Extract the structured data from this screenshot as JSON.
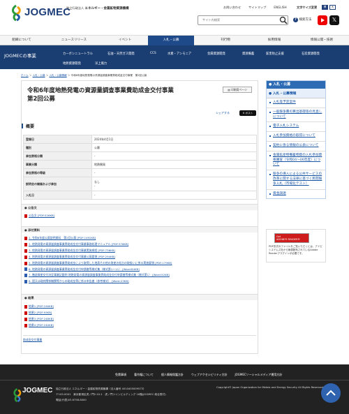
{
  "header": {
    "logo_text": "JOGMEC",
    "org_small": "独立行政法人",
    "org_main": "エネルギー・金属鉱物資源機構",
    "links": [
      "お問い合わせ",
      "サイトマップ",
      "ENGLISH"
    ],
    "font_size_label": "文字サイズ変更",
    "font_size_options": [
      "標",
      "大"
    ],
    "search_placeholder": "サイト内検索",
    "search_method": "検索方法"
  },
  "global_nav": [
    {
      "label": "組織について"
    },
    {
      "label": "ニュースリリース"
    },
    {
      "label": "イベント"
    },
    {
      "label": "入札・公募",
      "active": true
    },
    {
      "label": "刊行物"
    },
    {
      "label": "採用情報"
    },
    {
      "label": "情報公開・技術"
    }
  ],
  "sub_nav": {
    "title": "JOGMECの事業",
    "row1": [
      "カーボンニュートラル",
      "石油・天然ガス開発",
      "CCS",
      "水素・アンモニア",
      "金属資源開発",
      "資源備蓄",
      "鉱害防止支援",
      "石炭資源開発"
    ],
    "row2": [
      "地熱資源開発",
      "洋上風力"
    ]
  },
  "breadcrumb": [
    "ホーム",
    "入札・公募",
    "入札・公募情報",
    "令和6年度地熱発電の資源量調査事業費助成金交付事業　第2回公募"
  ],
  "page": {
    "title_line1": "令和6年度地熱発電の資源量調査事業費助成金交付事業",
    "title_line2": "第2回公募",
    "print_label": "印刷用ページ",
    "share_label": "シェアする",
    "x_post_label": "X ポスト",
    "overview_heading": "概要",
    "overview_rows": [
      {
        "label": "登録日",
        "value": "2024年4月1日"
      },
      {
        "label": "種別",
        "value": "公募"
      },
      {
        "label": "参加資格分類",
        "value": "-"
      },
      {
        "label": "事業分類",
        "value": "地熱開発"
      },
      {
        "label": "参加資格の等級",
        "value": "-"
      },
      {
        "label": "説明会の開催および参加",
        "value": "なし",
        "value2": "-"
      },
      {
        "label": "入札日",
        "value": "-"
      }
    ],
    "notice_heading": "公告文",
    "notice_files": [
      {
        "label": "公告文 [PDF:526KB]",
        "type": "pdf"
      }
    ],
    "attach_heading": "添付資料",
    "attach_files": [
      {
        "label": "1. 令和6年度公募説明資料　第2回公募 [PDF:1492KB]",
        "type": "pdf"
      },
      {
        "label": "2. 地熱発電の資源量調査事業費助成金交付事業事務処理マニュアル [PDF:376KB]",
        "type": "pdf"
      },
      {
        "label": "3. 地熱発電の資源量調査事業費助成金交付事業実施規程 [PDF:736KB]",
        "type": "pdf"
      },
      {
        "label": "4. 地熱発電の資源量調査事業費助成金交付事業公募要領 [PDF:294KB]",
        "type": "pdf"
      },
      {
        "label": "5. 地熱発電の資源量調査事業費助成金により取得した地表その他の財産の処分の取扱いに係る実施要領 [PDF:179KB]",
        "type": "pdf"
      },
      {
        "label": "6. 地熱発電の資源量調査事業費助成金交付申請書等様式集（様式第1〜11） [Word:84KB]",
        "type": "word"
      },
      {
        "label": "7. 撤退資産交付決定事業記載例 地熱発電の資源量調査事業費助成金交付申請書等様式集（様式第1） [Word:52KB]",
        "type": "word"
      },
      {
        "label": "8. 国又は政府関係機関等からの助成金等に係る申告書（参考様式） [Word:23KB]",
        "type": "word"
      }
    ],
    "result_heading": "結果",
    "result_files": [
      {
        "label": "結果1 [PDF:190KB]",
        "type": "pdf"
      },
      {
        "label": "結果2 [PDF:93KB]",
        "type": "pdf"
      },
      {
        "label": "結果3 [PDF:248KB]",
        "type": "pdf"
      },
      {
        "label": "結果4 [PDF:240KB]",
        "type": "pdf"
      }
    ],
    "bottom_link": "助成金交付事業"
  },
  "sidebar": {
    "header": "入札・公募",
    "sub_header": "入札・公募情報",
    "items": [
      "入札等予定案件",
      "一般競争費の算出基礎等の見直しについて",
      "電子入札システム",
      "入札参加資格の取得について",
      "契約に係る情報の公表について",
      "金属鉱産物備蓄物資の入札参加資格審査（令和04〜06年度）について",
      "競争の導入による公共サービスの改革に関する法律に基づく民間競争入札（市場化テスト）",
      "資金調達"
    ]
  },
  "adobe": {
    "badge_line1": "Get",
    "badge_line2": "ADOBE® READER®",
    "text": "PDF形式のファイルをご覧いただくには、アドビシステムズ社から無償配布されているAdobe Readerプラグインが必要です。"
  },
  "footer": {
    "links": [
      "免責事項",
      "著作権について",
      "個人情報保護方針",
      "ウェブアクセシビリティ方針",
      "JOGMECソーシャルメディア運用方針"
    ],
    "logo_text": "JOGMEC",
    "org": "独立行政法人 エネルギー・金属鉱物資源機構（法人番号 4010405009573）",
    "address": "〒105-0001　東京都港区虎ノ門2-10-1　虎ノ門ツインビルディング 16階(JOGMEC 総合受付)",
    "tel": "電話(代表)03-6758-8000",
    "copyright": "Copyright© Japan Organization for Metals and Energy Security All Rights Reserved."
  },
  "colors": {
    "brand": "#1f4a8a",
    "subnav": "#1b3e72",
    "link": "#1a56a6",
    "footer": "#222222"
  }
}
